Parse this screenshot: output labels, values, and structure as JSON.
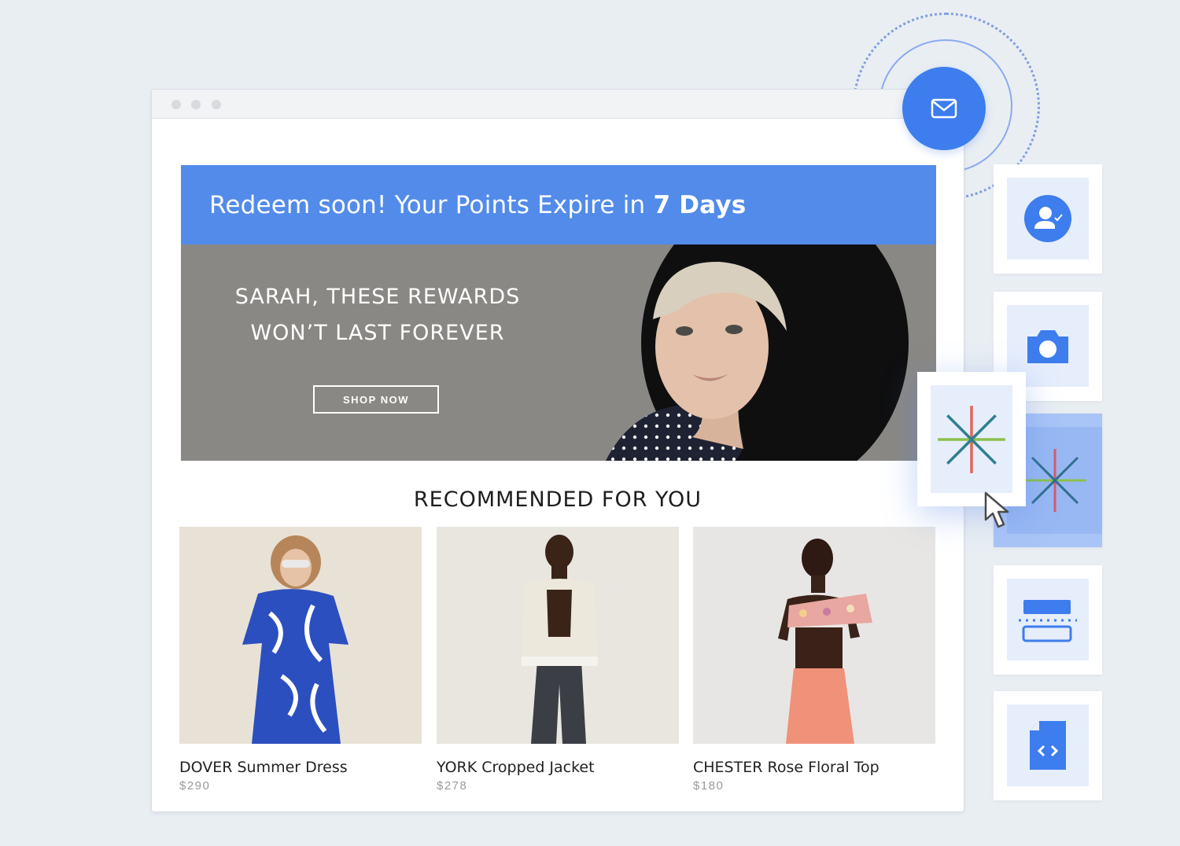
{
  "email": {
    "banner_lead": "Redeem soon! Your Points Expire in ",
    "banner_strong": "7 Days",
    "hero_line1": "SARAH, THESE REWARDS",
    "hero_line2": "WON’T LAST FOREVER",
    "shop_button": "SHOP NOW",
    "section_title": "RECOMMENDED FOR YOU",
    "products": [
      {
        "name": "DOVER Summer Dress",
        "price": "$290"
      },
      {
        "name": "YORK Cropped Jacket",
        "price": "$278"
      },
      {
        "name": "CHESTER Rose Floral Top",
        "price": "$180"
      }
    ]
  },
  "tools": [
    {
      "icon": "user-check-icon"
    },
    {
      "icon": "camera-icon"
    },
    {
      "icon": "asterisk-logo-icon"
    },
    {
      "icon": "form-layout-icon"
    },
    {
      "icon": "code-file-icon"
    }
  ],
  "colors": {
    "accent": "#528be9",
    "badge": "#3d7ded",
    "tool_tile": "#e6eefc",
    "hero_bg": "#8a8884"
  }
}
